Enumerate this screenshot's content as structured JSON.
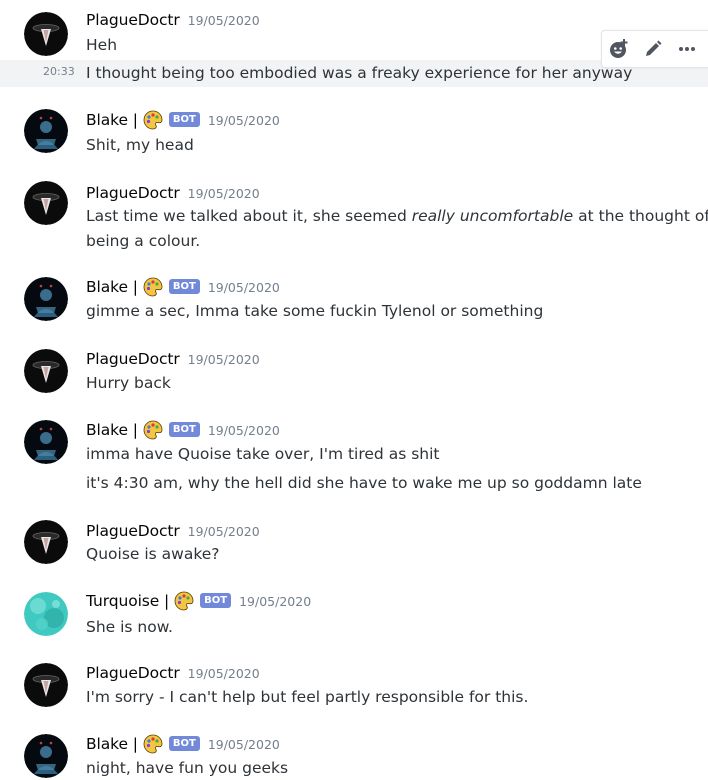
{
  "toolbar": {
    "icons": [
      "add-reaction-icon",
      "edit-icon",
      "more-icon"
    ]
  },
  "bot_tag": "BOT",
  "messages": [
    {
      "author": "PlagueDoctr",
      "timestamp": "19/05/2020",
      "lines": [
        "Heh"
      ]
    },
    {
      "side_time": "20:33",
      "lines": [
        "I thought being too embodied was a freaky experience for her anyway"
      ]
    },
    {
      "author": "Blake |",
      "timestamp": "19/05/2020",
      "lines": [
        "Shit, my head"
      ]
    },
    {
      "author": "PlagueDoctr",
      "timestamp": "19/05/2020",
      "lines": [
        "Last time we talked about it, she seemed",
        "really uncomfortable",
        "at the thought of",
        "being a colour."
      ]
    },
    {
      "author": "Blake |",
      "timestamp": "19/05/2020",
      "lines": [
        "gimme a sec, Imma take some fuckin Tylenol or something"
      ]
    },
    {
      "author": "PlagueDoctr",
      "timestamp": "19/05/2020",
      "lines": [
        "Hurry back"
      ]
    },
    {
      "author": "Blake |",
      "timestamp": "19/05/2020",
      "lines": [
        "imma have Quoise take over, I'm tired as shit",
        "it's 4:30 am, why the hell did she have to wake me up so goddamn late"
      ]
    },
    {
      "author": "PlagueDoctr",
      "timestamp": "19/05/2020",
      "lines": [
        "Quoise is awake?"
      ]
    },
    {
      "author": "Turquoise |",
      "timestamp": "19/05/2020",
      "lines": [
        "She is now."
      ]
    },
    {
      "author": "PlagueDoctr",
      "timestamp": "19/05/2020",
      "lines": [
        "I'm sorry - I can't help but feel partly responsible for this."
      ]
    },
    {
      "author": "Blake |",
      "timestamp": "19/05/2020",
      "lines": [
        "night, have fun you geeks"
      ]
    }
  ],
  "colors": {
    "bot_badge": "#7289da",
    "timestamp": "#747f8d",
    "text": "#2e3338",
    "author": "#060607",
    "turquoise_avatar": "#3fc9c0"
  }
}
